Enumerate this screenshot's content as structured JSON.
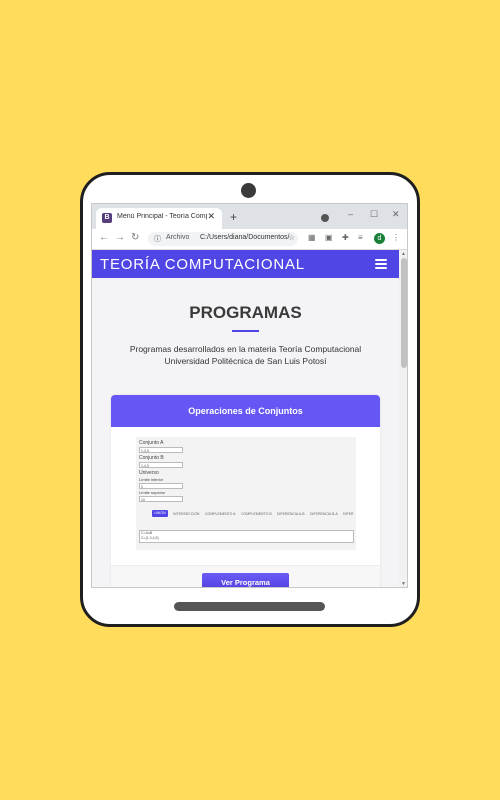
{
  "browser": {
    "tab_title": "Menú Principal - Teoría Computacional",
    "tab_close": "✕",
    "new_tab": "+",
    "favicon_letter": "B",
    "address_prefix": "Archivo",
    "address_url": "C:/Users/diana/Documentos/",
    "profile_initial": "d",
    "window_controls": [
      "–",
      "☐",
      "✕"
    ]
  },
  "site": {
    "brand": "TEORÍA COMPUTACIONAL",
    "nav_color": "#5046e5"
  },
  "programs_section": {
    "title": "PROGRAMAS",
    "description_line1": "Programas desarrollados en la materia Teoría Computacional",
    "description_line2": "Universidad Politécnica de San Luis Potosí"
  },
  "card": {
    "header": "Operaciones de Conjuntos",
    "header_color": "#6657f5",
    "button_label": "Ver Programa",
    "preview": {
      "label_a": "Conjunto A",
      "value_a": "1,3,5",
      "label_b": "Conjunto B",
      "value_b": "1,4,5",
      "label_universe": "Universo",
      "label_lower": "Límite inferior",
      "value_lower": "0",
      "label_upper": "Límite superior",
      "value_upper": "10",
      "buttons": [
        "UNIÓN",
        "INTERSECCIÓN",
        "COMPLEMENTO A",
        "COMPLEMENTO B",
        "DIFERENCIA A-B",
        "DIFERENCIA B-A",
        "DIFER"
      ],
      "output_line1": "C=AuB",
      "output_line2": "C={1,3,4,5}"
    }
  }
}
